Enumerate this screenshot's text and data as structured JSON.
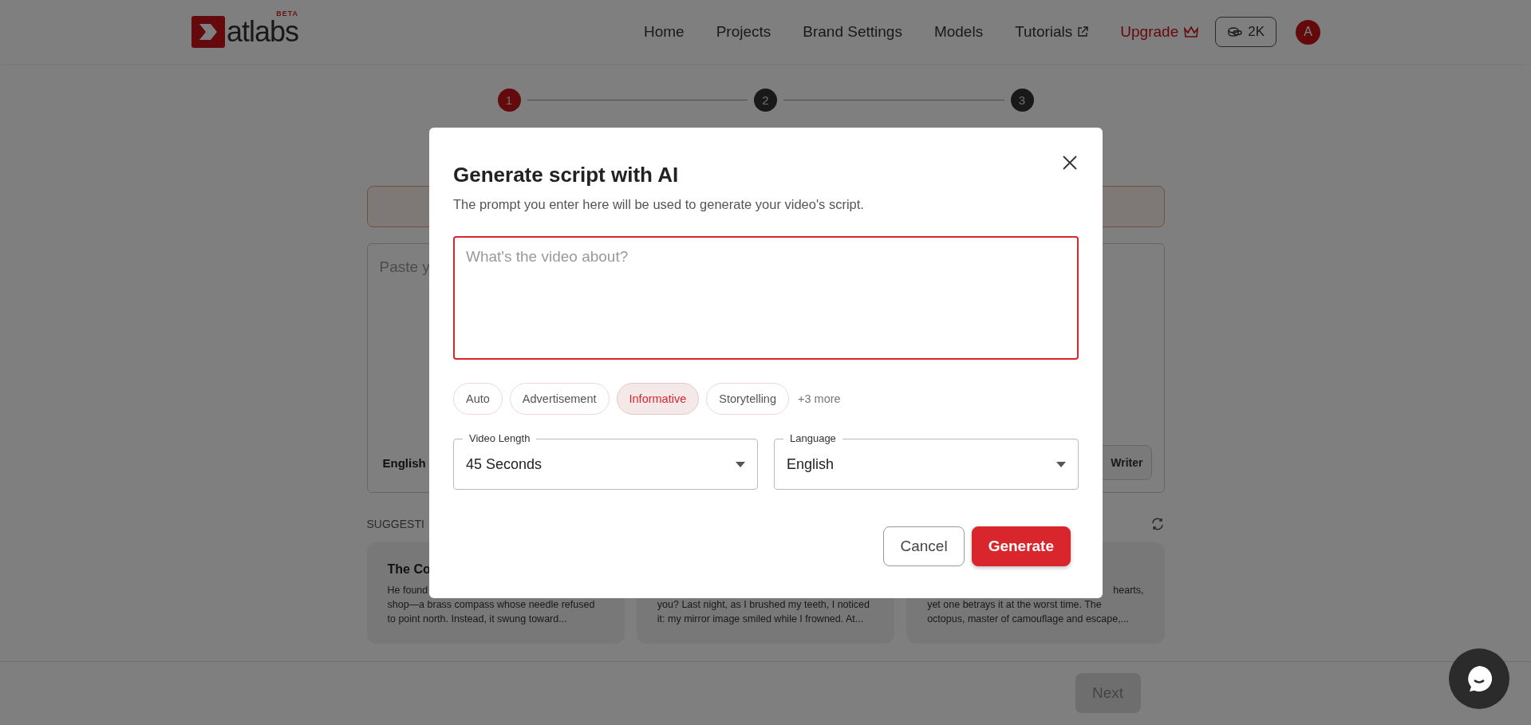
{
  "header": {
    "logo": {
      "text": "atlabs",
      "badge": "BETA"
    },
    "nav": [
      {
        "label": "Home",
        "external": false
      },
      {
        "label": "Projects",
        "external": false
      },
      {
        "label": "Brand Settings",
        "external": false
      },
      {
        "label": "Models",
        "external": false
      },
      {
        "label": "Tutorials",
        "external": true
      }
    ],
    "upgrade": "Upgrade",
    "credits": "2K",
    "avatar": "A"
  },
  "stepper": [
    {
      "label": "1",
      "selected": true
    },
    {
      "label": "2",
      "selected": false
    },
    {
      "label": "3",
      "selected": false
    }
  ],
  "background": {
    "script_field": "Paste y",
    "language": "English",
    "writer_button": "Writer",
    "suggestions_label": "SUGGESTI",
    "cards": [
      {
        "title": "The Co",
        "lines": [
          {
            "text": "He found",
            "kind": "start"
          },
          {
            "text": "shop—a brass compass whose needle refused",
            "kind": "start"
          },
          {
            "text": "to point north. Instead, it swung toward...",
            "kind": "start"
          }
        ]
      },
      {
        "lines": [
          {
            "text": "you? Last night, as I brushed my teeth, I noticed",
            "kind": "start"
          },
          {
            "text": "it: my mirror image smiled while I frowned. At...",
            "kind": "start"
          }
        ]
      },
      {
        "lines": [
          {
            "text": "hearts,",
            "kind": "end"
          },
          {
            "text": "yet one betrays it at the worst time. The",
            "kind": "start"
          },
          {
            "text": "octopus, master of camouflage and escape,...",
            "kind": "start"
          }
        ]
      }
    ],
    "next_button": "Next"
  },
  "dialog": {
    "title": "Generate script with AI",
    "subtitle": "The prompt you enter here will be used to generate your video's script.",
    "prompt": {
      "placeholder": "What's the video about?"
    },
    "styles": [
      {
        "label": "Auto",
        "selected": false
      },
      {
        "label": "Advertisement",
        "selected": false
      },
      {
        "label": "Informative",
        "selected": true
      },
      {
        "label": "Storytelling",
        "selected": false
      }
    ],
    "more": "+3 more",
    "selects": [
      {
        "label": "Video Length",
        "value": "45 Seconds"
      },
      {
        "label": "Language",
        "value": "English"
      }
    ],
    "buttons": [
      {
        "label": "Cancel",
        "kind": "secondary"
      },
      {
        "label": "Generate",
        "kind": "primary"
      }
    ]
  }
}
